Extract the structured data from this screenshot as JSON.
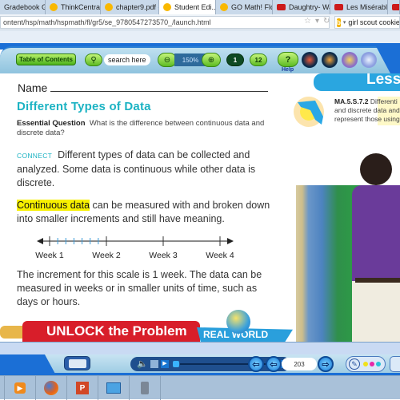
{
  "browser": {
    "tabs": [
      {
        "label": "Gradebook Grid",
        "icon": "no-favicon",
        "active": false
      },
      {
        "label": "ThinkCentral",
        "icon": "circle-favicon-icon",
        "active": false
      },
      {
        "label": "chapter9.pdf - ...",
        "icon": "circle-favicon-icon",
        "active": false
      },
      {
        "label": "Student Edi...",
        "icon": "circle-favicon-icon",
        "active": true
      },
      {
        "label": "GO Math! Flori...",
        "icon": "circle-favicon-icon",
        "active": false
      },
      {
        "label": "Daughtry- Wai...",
        "icon": "youtube-icon",
        "active": false
      },
      {
        "label": "Les Misérables...",
        "icon": "youtube-icon",
        "active": false
      }
    ],
    "close_tab_glyph": "×",
    "url": "ontent/hsp/math/hspmath/fl/gr5/se_9780547273570_/launch.html",
    "search_query": "girl scout cookies",
    "search_engine_glyph": "b"
  },
  "reader_toolbar": {
    "toc_label": "Table of Contents",
    "search_placeholder": "search here",
    "zoom_level": "150%",
    "single_page_label": "1",
    "double_page_label": "12",
    "help_glyph": "?",
    "help_label": "Help"
  },
  "page": {
    "lesson_label": "Lesso",
    "name_label": "Name",
    "title": "Different Types of Data",
    "essential_question_label": "Essential Question",
    "essential_question": "What is the difference between continuous data and discrete data?",
    "connect_label": "CONNECT",
    "connect_text": "Different types of data can be collected and analyzed. Some data is continuous while other data is discrete.",
    "continuous_term": "Continuous data",
    "continuous_text": "can be measured with and broken down into smaller increments and still have meaning.",
    "number_line": {
      "labels": [
        "Week 1",
        "Week 2",
        "Week 3",
        "Week 4"
      ],
      "minor_ticks_between_week1_week2": 6
    },
    "increment_text": "The increment for this scale is 1 week. The data can be measured in weeks or in smaller units of time, such as days or hours.",
    "standard_code": "MA.5.S.7.2",
    "standard_text": "Differenti and discrete data and represent those using g",
    "unlock_label": "UNLOCK the Problem",
    "real_world_label": "REAL WORLD"
  },
  "player": {
    "page_number": "203",
    "colors": {
      "yellow": "#f1e21a",
      "magenta": "#e62aa8",
      "cyan": "#27c5d6"
    }
  },
  "taskbar": {
    "items": [
      "media-player-icon",
      "firefox-icon",
      "powerpoint-icon",
      "network-icon",
      "camera-icon"
    ]
  },
  "theme": {
    "accent": "#1b6fd6",
    "title_color": "#1cb3c3",
    "highlight": "#f7f000",
    "unlock_red": "#d81e2a"
  }
}
